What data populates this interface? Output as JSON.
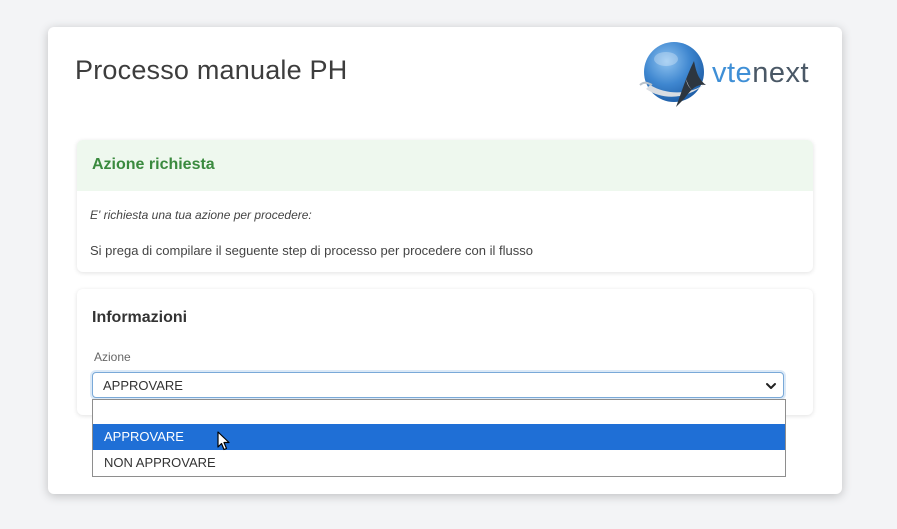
{
  "page": {
    "title": "Processo manuale PH"
  },
  "logo": {
    "part1": "vte",
    "part2": "next",
    "icon": "orca-globe-icon"
  },
  "action_panel": {
    "title": "Azione richiesta",
    "intro": "E' richiesta una tua azione per procedere:",
    "message": "Si prega di compilare il seguente step di processo per procedere con il flusso"
  },
  "info_panel": {
    "title": "Informazioni",
    "field_label": "Azione",
    "selected_value": "APPROVARE",
    "options": [
      "",
      "APPROVARE",
      "NON APPROVARE"
    ],
    "highlighted_option": "APPROVARE"
  },
  "colors": {
    "accent_green": "#3a8a3e",
    "header_green_bg": "#eef8ee",
    "highlight_blue": "#1f6fd6",
    "logo_blue": "#3f8fd6",
    "logo_gray": "#4a5866"
  }
}
